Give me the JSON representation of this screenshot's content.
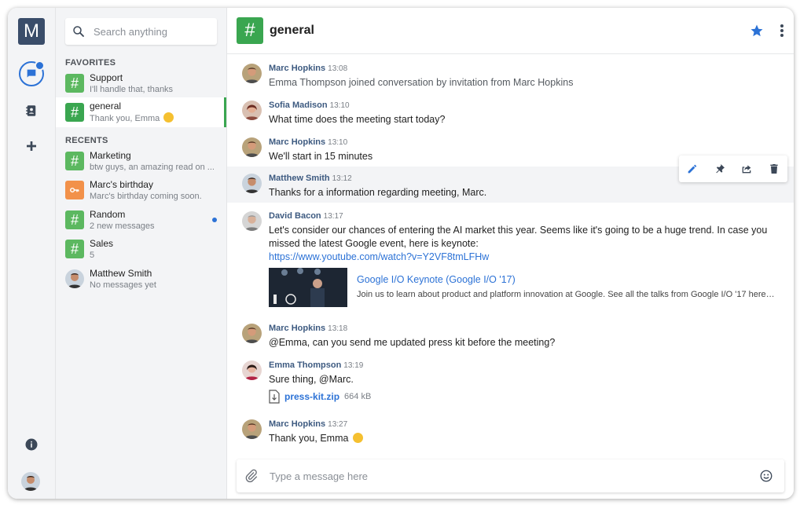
{
  "rail": {
    "logo_letter": "M"
  },
  "search": {
    "placeholder": "Search anything"
  },
  "sidebar": {
    "favorites_label": "FAVORITES",
    "recents_label": "RECENTS",
    "favorites": [
      {
        "name": "Support",
        "sub": "I'll handle that, thanks",
        "icon": "hash-icon",
        "color": "#5cb860"
      },
      {
        "name": "general",
        "sub": "Thank you, Emma",
        "icon": "hash-icon",
        "color": "#3aa650",
        "active": true
      }
    ],
    "recents": [
      {
        "name": "Marketing",
        "sub": "btw guys, an amazing read on ...",
        "icon": "hash-icon",
        "color": "#5cb860"
      },
      {
        "name": "Marc's birthday",
        "sub": "Marc's birthday coming soon.",
        "icon": "key-icon",
        "color": "#f2914a"
      },
      {
        "name": "Random",
        "sub": "2 new messages",
        "icon": "hash-icon",
        "color": "#5cb860",
        "unread": true
      },
      {
        "name": "Sales",
        "sub": "5",
        "icon": "hash-icon",
        "color": "#5cb860"
      },
      {
        "name": "Matthew Smith",
        "sub": "No messages yet",
        "icon": "avatar"
      }
    ]
  },
  "header": {
    "hash": "#",
    "title": "general"
  },
  "messages": [
    {
      "author": "Marc Hopkins",
      "time": "13:08",
      "text": "Emma Thompson joined conversation by invitation from Marc Hopkins"
    },
    {
      "author": "Sofia Madison",
      "time": "13:10",
      "text": "What time does the meeting start today?"
    },
    {
      "author": "Marc Hopkins",
      "time": "13:10",
      "text": "We'll start in 15 minutes"
    },
    {
      "author": "Matthew Smith",
      "time": "13:12",
      "text": "Thanks for a information regarding meeting, Marc."
    },
    {
      "author": "David Bacon",
      "time": "13:17",
      "text": "Let's consider our chances of entering the AI market this year. Seems like it's going to be a huge trend. In case you missed the latest Google event, here is keynote:",
      "link": "https://www.youtube.com/watch?v=Y2VF8tmLFHw",
      "preview_title": "Google I/O Keynote (Google I/O '17)",
      "preview_desc": "Join us to learn about product and platform innovation at Google. See all the talks from Google I/O '17 here…"
    },
    {
      "author": "Marc Hopkins",
      "time": "13:18",
      "text": "@Emma, can you send me updated press kit before the meeting?"
    },
    {
      "author": "Emma Thompson",
      "time": "13:19",
      "text": "Sure thing, @Marc.",
      "file_name": "press-kit.zip",
      "file_size": "664 kB"
    },
    {
      "author": "Marc Hopkins",
      "time": "13:27",
      "text": "Thank you, Emma"
    }
  ],
  "composer": {
    "placeholder": "Type a message here"
  },
  "colors": {
    "accent": "#2c72d6",
    "channel_green": "#3aa650",
    "author": "#3d5a80"
  }
}
